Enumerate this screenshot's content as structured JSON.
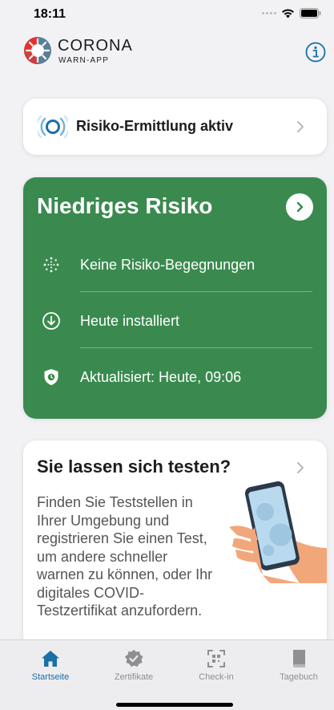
{
  "status_bar": {
    "time": "18:11"
  },
  "header": {
    "logo_title": "CORONA",
    "logo_subtitle": "WARN-APP",
    "info_icon": "info-circle-icon"
  },
  "tracing_card": {
    "label": "Risiko-Ermittlung aktiv",
    "icon": "tracing-waves-icon"
  },
  "risk_card": {
    "title": "Niedriges Risiko",
    "color": "#3a8a4f",
    "rows": [
      {
        "icon": "virus-dots-icon",
        "text": "Keine Risiko-Begegnungen"
      },
      {
        "icon": "download-circle-icon",
        "text": "Heute installiert"
      },
      {
        "icon": "shield-clock-icon",
        "text": "Aktualisiert: Heute, 09:06"
      }
    ]
  },
  "test_card": {
    "title": "Sie lassen sich testen?",
    "body": "Finden Sie Teststellen in Ihrer Umgebung und registrieren Sie einen Test, um andere schneller warnen zu können, oder Ihr digitales COVID-Testzertifikat anzufordern."
  },
  "tabs": [
    {
      "label": "Startseite",
      "icon": "home-icon",
      "active": true
    },
    {
      "label": "Zertifikate",
      "icon": "certificate-badge-icon",
      "active": false
    },
    {
      "label": "Check-in",
      "icon": "qr-scan-icon",
      "active": false
    },
    {
      "label": "Tagebuch",
      "icon": "book-icon",
      "active": false
    }
  ],
  "colors": {
    "accent": "#1a6fa6",
    "risk_green": "#3a8a4f",
    "background": "#f2f2f4"
  }
}
